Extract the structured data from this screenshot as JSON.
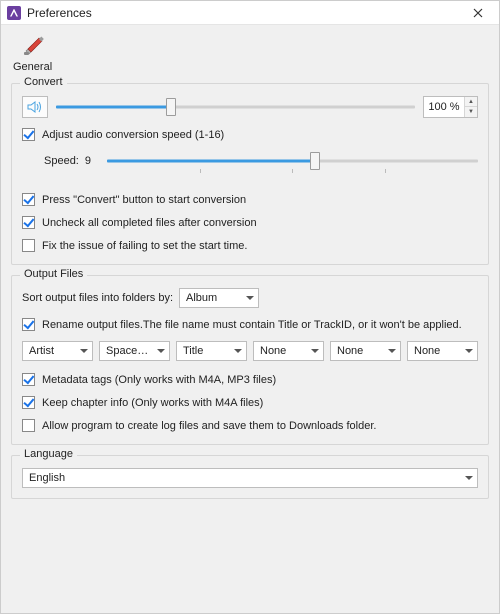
{
  "window": {
    "title": "Preferences"
  },
  "tabs": {
    "general": "General"
  },
  "convert": {
    "title": "Convert",
    "volume_pct": "100 %",
    "volume_fill_pct": 32,
    "adjust_speed_label": "Adjust audio conversion speed (1-16)",
    "adjust_speed_checked": true,
    "speed_label": "Speed:",
    "speed_value": "9",
    "speed_fill_pct": 56,
    "press_convert_label": "Press \"Convert\" button to start conversion",
    "press_convert_checked": true,
    "uncheck_completed_label": "Uncheck all completed files after conversion",
    "uncheck_completed_checked": true,
    "fix_start_label": "Fix the issue of failing to set the start time.",
    "fix_start_checked": false
  },
  "output": {
    "title": "Output Files",
    "sort_label": "Sort output files into folders by:",
    "sort_value": "Album",
    "rename_label": "Rename output files.The file name must contain Title or TrackID, or it won't be applied.",
    "rename_checked": true,
    "pattern": [
      "Artist",
      "Space-Space",
      "Title",
      "None",
      "None",
      "None"
    ],
    "metadata_label": "Metadata tags (Only works with M4A, MP3 files)",
    "metadata_checked": true,
    "chapter_label": "Keep chapter info (Only works with M4A files)",
    "chapter_checked": true,
    "log_label": "Allow program to create log files and save them to Downloads folder.",
    "log_checked": false
  },
  "language": {
    "title": "Language",
    "value": "English"
  }
}
